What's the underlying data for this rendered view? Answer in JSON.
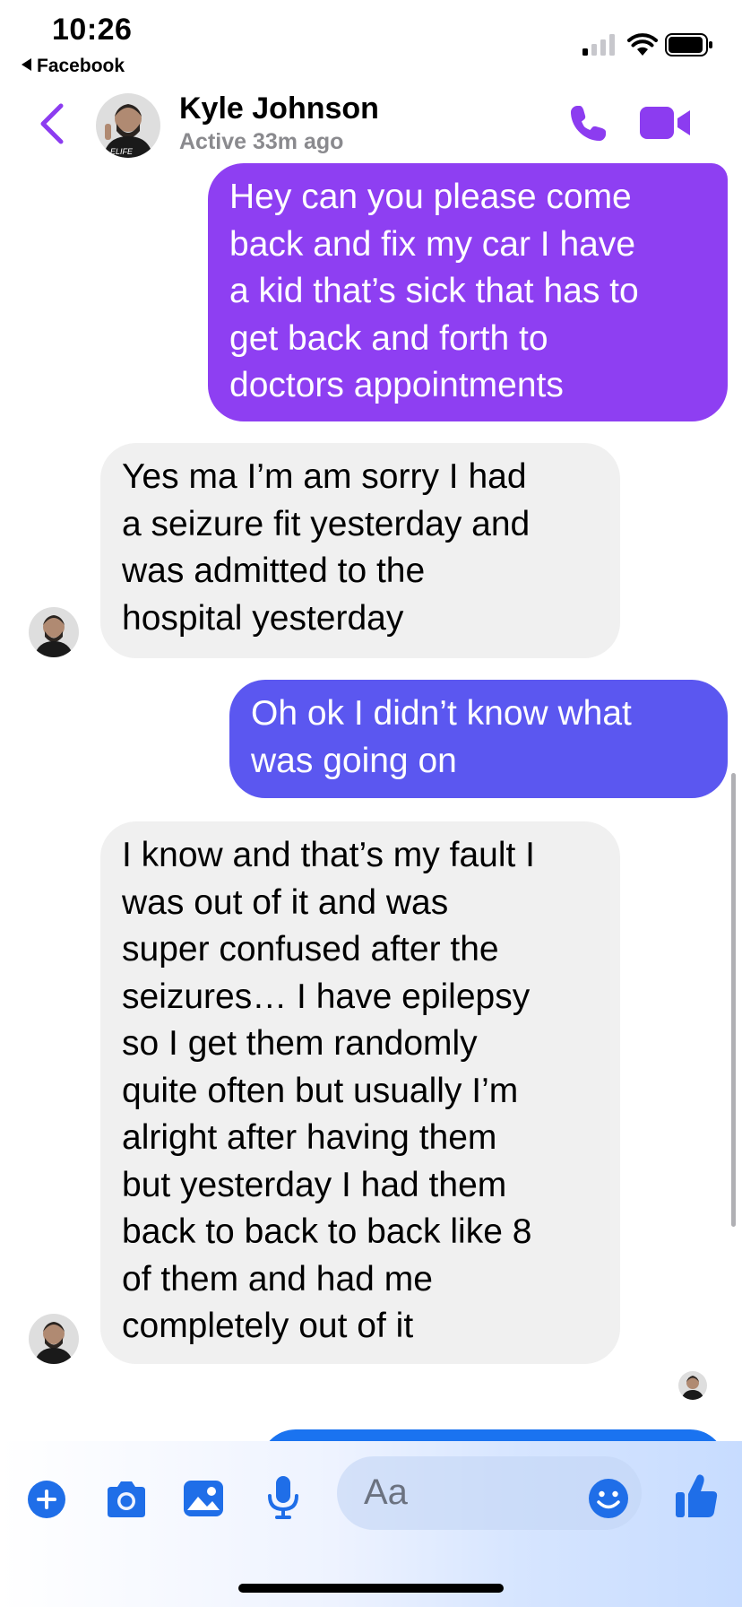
{
  "status_bar": {
    "time": "10:26",
    "back_app": "Facebook"
  },
  "header": {
    "contact_name": "Kyle Johnson",
    "active_status": "Active 33m ago",
    "back_icon": "chevron-left-icon",
    "call_icon": "phone-icon",
    "video_icon": "video-camera-icon"
  },
  "messages": [
    {
      "direction": "sent",
      "text": "Hey can you please come\nback and fix my car I have\na kid that’s sick that has to\nget back and forth to\ndoctors appointments"
    },
    {
      "direction": "received",
      "text": "Yes ma I’m am sorry I had\na seizure fit yesterday and\nwas admitted to the\nhospital yesterday"
    },
    {
      "direction": "sent",
      "text": "Oh ok  I didn’t know what\nwas going on"
    },
    {
      "direction": "received",
      "text": "I know and that’s my fault I\nwas out of it and was\nsuper confused after the\nseizures… I have epilepsy\nso I get them randomly\nquite often but usually I’m\nalright after having them\nbut yesterday I had them\nback to back to back like 8\nof them and had me\ncompletely out of it"
    }
  ],
  "composer": {
    "placeholder": "Aa",
    "icons": [
      "plus-icon",
      "camera-icon",
      "photo-icon",
      "microphone-icon",
      "emoji-icon",
      "thumbs-up-icon"
    ]
  },
  "colors": {
    "accent": "#8c3cf0",
    "sent_bubble_1": "#8e3ff2",
    "sent_bubble_2": "#5b57f0",
    "received_bubble": "#f0f0f0",
    "composer_icon": "#1f6ee8"
  }
}
